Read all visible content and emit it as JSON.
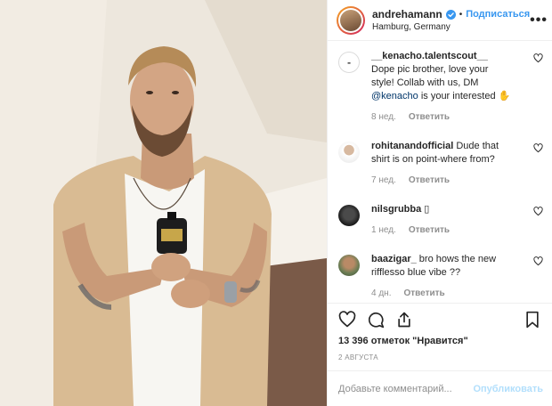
{
  "header": {
    "username": "andrehamann",
    "follow_label": "Подписаться",
    "location": "Hamburg, Germany",
    "verified_icon": "verified-badge-icon",
    "more_label": "•••"
  },
  "comments": [
    {
      "username": "__kenacho.talentscout__",
      "text_before": " Dope pic brother, love your style! Collab with us, DM ",
      "mention": "@kenacho",
      "text_after": " is your interested ✋",
      "time": "8 нед.",
      "reply_label": "Ответить"
    },
    {
      "username": "rohitanandofficial",
      "text_before": " Dude that shirt is on point-where from?",
      "time": "7 нед.",
      "reply_label": "Ответить"
    },
    {
      "username": "nilsgrubba",
      "text_before": " ▯",
      "time": "1 нед.",
      "reply_label": "Ответить"
    },
    {
      "username": "baazigar_",
      "text_before": " bro hows the new rifflesso blue vibe ??",
      "time": "4 дн.",
      "reply_label": "Ответить"
    }
  ],
  "actions": {
    "likes": "13 396 отметок \"Нравится\"",
    "date": "2 АВГУСТА"
  },
  "add_comment": {
    "placeholder": "Добавьте комментарий...",
    "publish_label": "Опубликовать"
  },
  "colors": {
    "accent": "#3897f0",
    "publish_disabled": "#b2dffc",
    "meta_text": "#8e8e8e"
  }
}
